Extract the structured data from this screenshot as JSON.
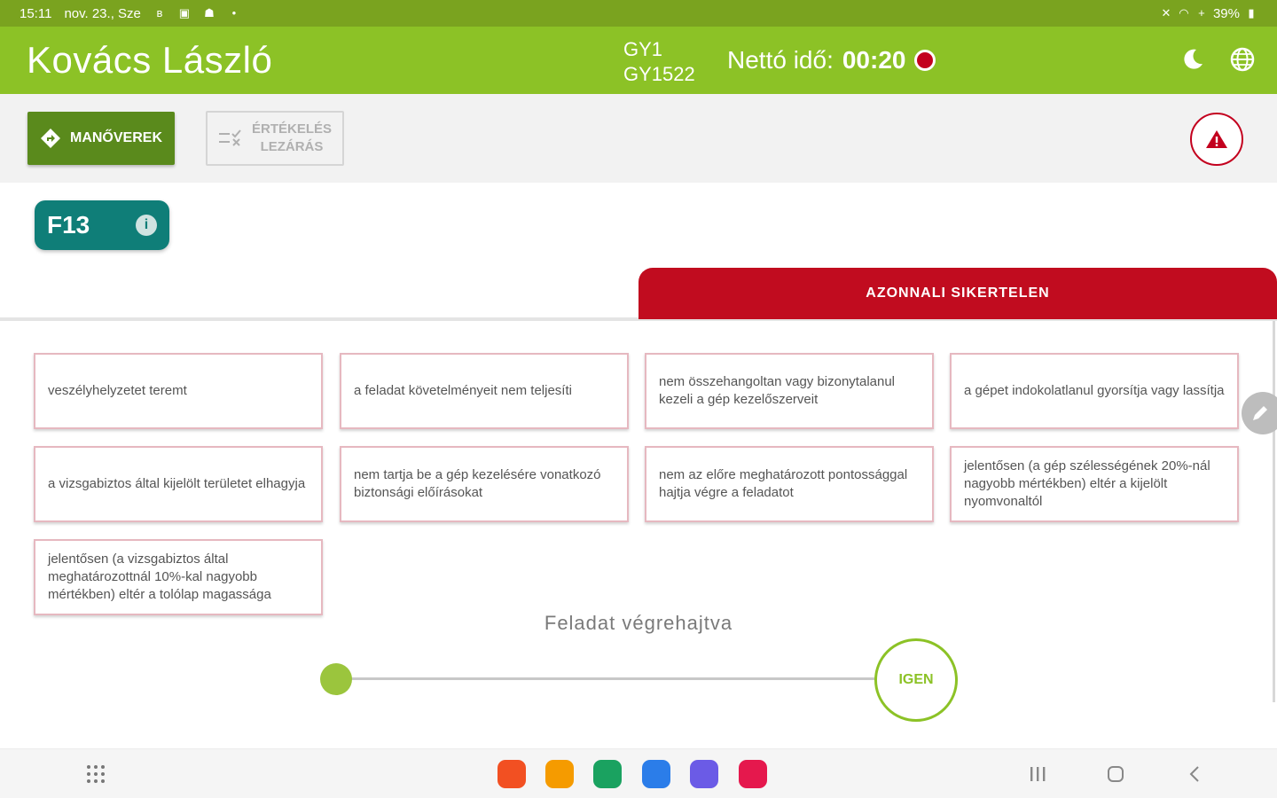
{
  "status_bar": {
    "time": "15:11",
    "date": "nov. 23., Sze",
    "battery": "39%"
  },
  "header": {
    "name": "Kovács László",
    "code_line1": "GY1",
    "code_line2": "GY1522",
    "netto_label": "Nettó idő:",
    "netto_time": "00:20"
  },
  "toolbar": {
    "manoverek_label": "MANŐVEREK",
    "ertekeles_line1": "ÉRTÉKELÉS",
    "ertekeles_line2": "LEZÁRÁS"
  },
  "task": {
    "code": "F13",
    "info_symbol": "i"
  },
  "tab": {
    "label": "AZONNALI SIKERTELEN"
  },
  "criteria": [
    "veszélyhelyzetet teremt",
    "a feladat követelményeit nem teljesíti",
    "nem összehangoltan vagy bizonytalanul kezeli a gép kezelőszerveit",
    "a gépet indokolatlanul gyorsítja vagy lassítja",
    "a vizsgabiztos által kijelölt területet elhagyja",
    "nem tartja be a gép kezelésére vonatkozó biztonsági előírásokat",
    "nem az előre meghatározott pontossággal hajtja végre a feladatot",
    "jelentősen (a gép szélességének 20%-nál nagyobb mértékben) eltér a kijelölt nyomvonaltól",
    "jelentősen (a vizsgabiztos által meghatározottnál 10%-kal nagyobb mértékben) eltér a tolólap magassága"
  ],
  "slider": {
    "label": "Feladat végrehajtva",
    "end_label": "IGEN",
    "value": 0
  },
  "colors": {
    "header_green": "#8cc226",
    "status_green": "#7aa31f",
    "button_green": "#5a8a1c",
    "teal": "#0f7e78",
    "red": "#c10c1f"
  }
}
